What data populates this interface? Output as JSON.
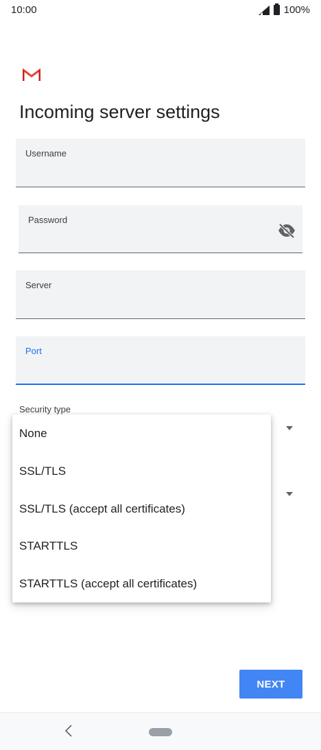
{
  "status_bar": {
    "time": "10:00",
    "battery": "100%"
  },
  "app": {
    "logo": "gmail-logo",
    "title": "Incoming server settings"
  },
  "fields": {
    "username": {
      "label": "Username",
      "value": ""
    },
    "password": {
      "label": "Password",
      "value": "",
      "toggle_icon": "visibility-off-icon"
    },
    "server": {
      "label": "Server",
      "value": ""
    },
    "port": {
      "label": "Port",
      "value": ""
    }
  },
  "security_type": {
    "label": "Security type",
    "options": [
      "None",
      "SSL/TLS",
      "SSL/TLS (accept all certificates)",
      "STARTTLS",
      "STARTTLS (accept all certificates)"
    ]
  },
  "actions": {
    "next_label": "NEXT"
  },
  "colors": {
    "accent": "#1a73e8",
    "button": "#4285f4",
    "field_bg": "#f1f3f4",
    "gmail_red": "#ea4335"
  },
  "nav": {
    "back_icon": "back-chevron-icon",
    "home_icon": "home-pill-icon"
  }
}
